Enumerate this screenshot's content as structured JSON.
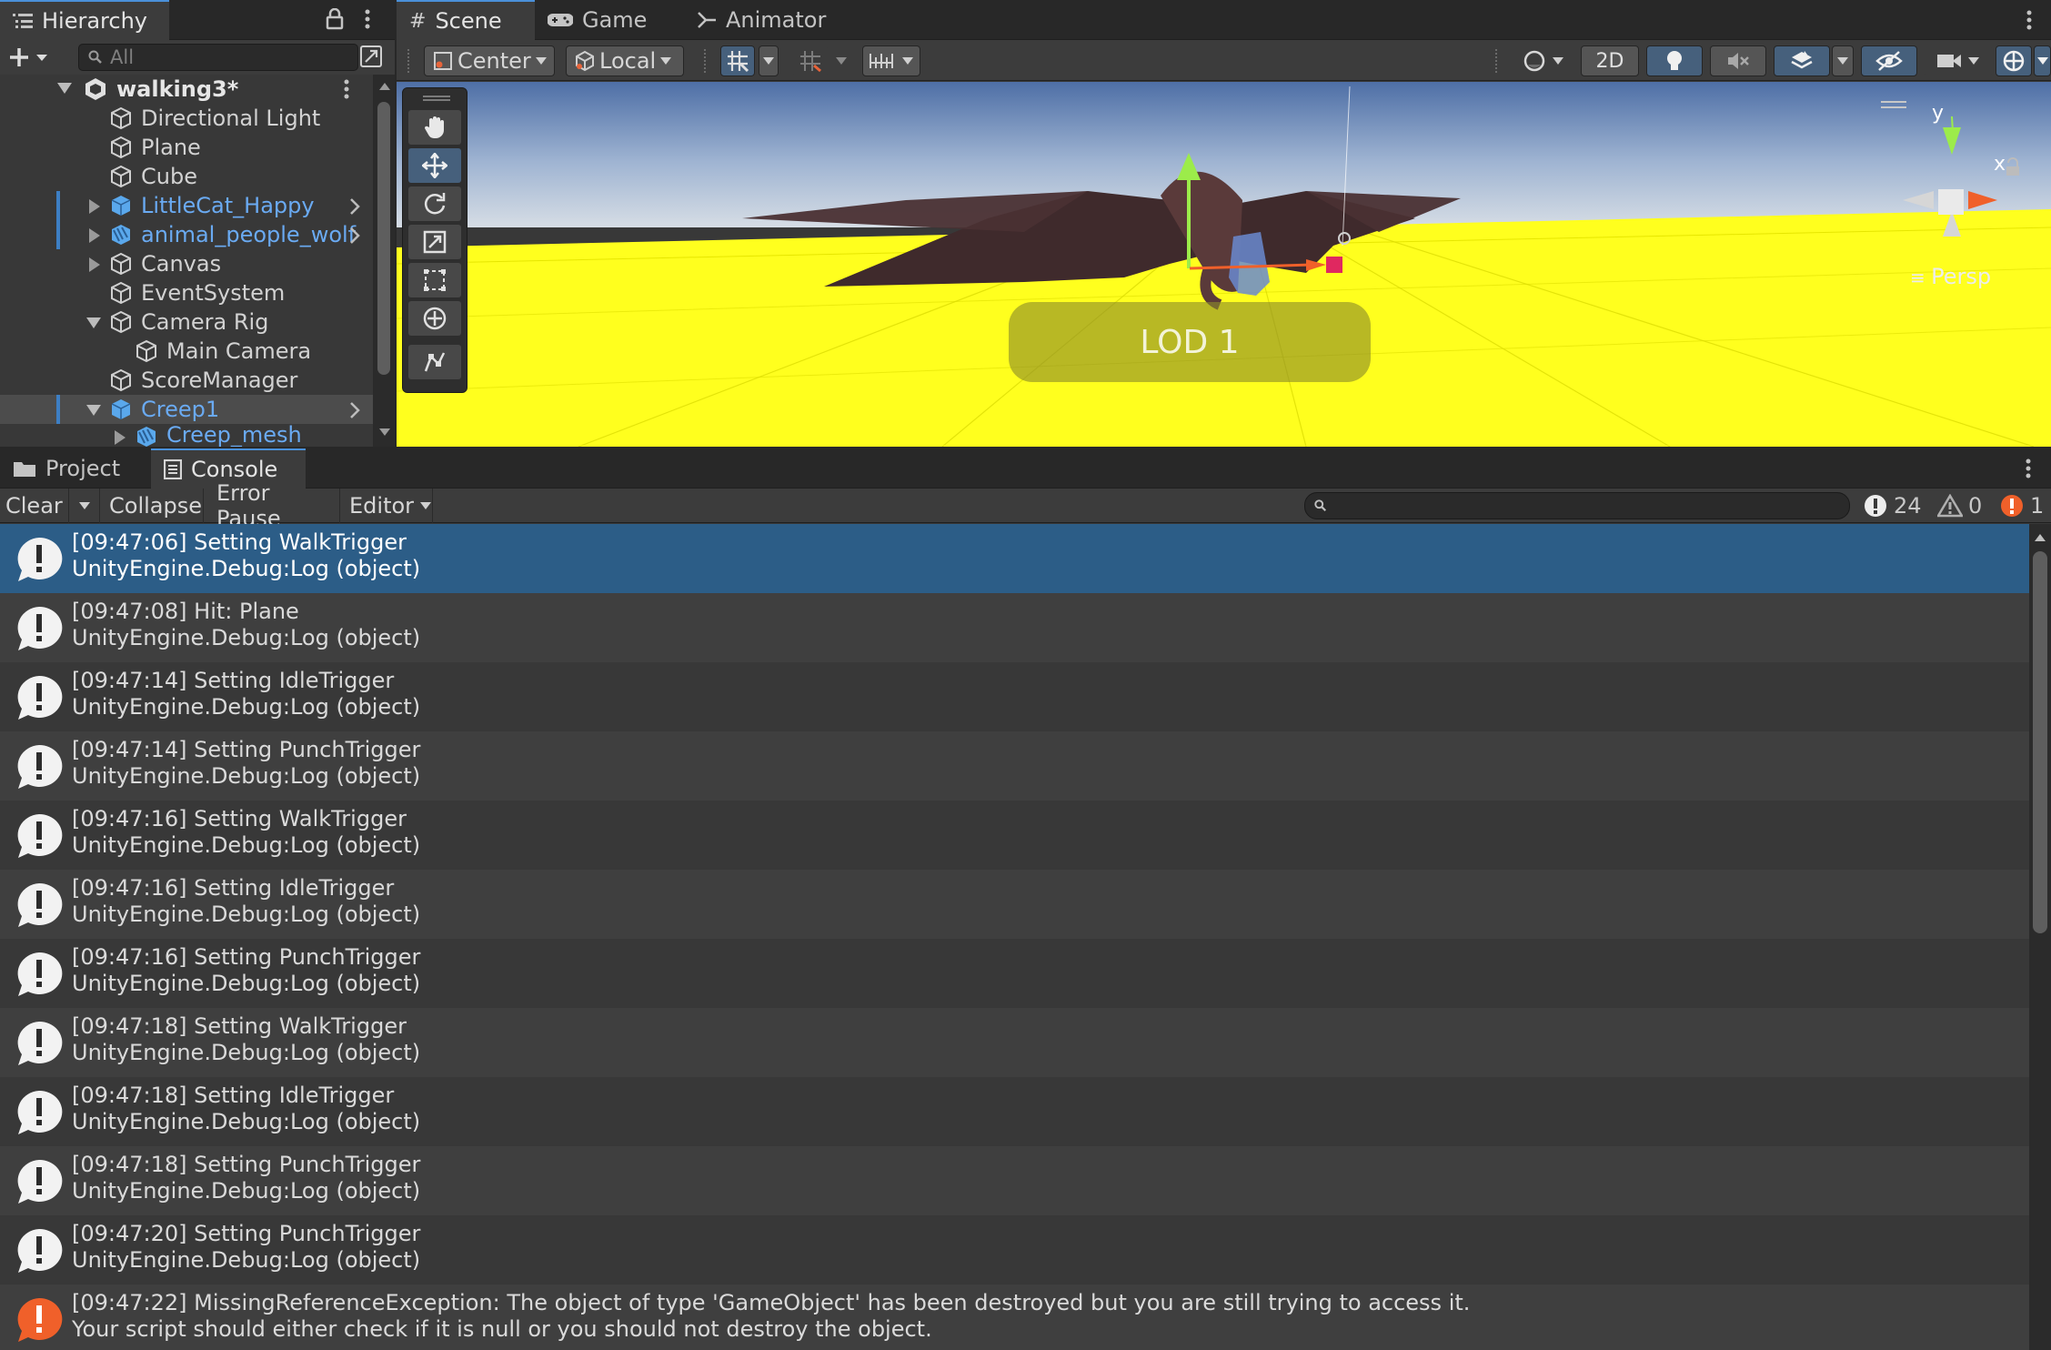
{
  "hierarchy": {
    "tab_label": "Hierarchy",
    "search_placeholder": "All",
    "scene_name": "walking3*",
    "items": [
      {
        "label": "Directional Light"
      },
      {
        "label": "Plane"
      },
      {
        "label": "Cube"
      },
      {
        "label": "LittleCat_Happy"
      },
      {
        "label": "animal_people_wolf"
      },
      {
        "label": "Canvas"
      },
      {
        "label": "EventSystem"
      },
      {
        "label": "Camera Rig"
      },
      {
        "label": "Main Camera"
      },
      {
        "label": "ScoreManager"
      },
      {
        "label": "Creep1"
      },
      {
        "label": "Creep_mesh"
      }
    ]
  },
  "scene_tabs": {
    "scene": "Scene",
    "game": "Game",
    "animator": "Animator"
  },
  "scene_toolbar": {
    "pivot": "Center",
    "space": "Local",
    "mode_2d": "2D"
  },
  "scene_view": {
    "lod_label": "LOD 1",
    "gizmo_y": "y",
    "gizmo_x": "x",
    "projection": "Persp"
  },
  "bottom_tabs": {
    "project": "Project",
    "console": "Console"
  },
  "console_toolbar": {
    "clear": "Clear",
    "collapse": "Collapse",
    "error_pause": "Error Pause",
    "editor": "Editor",
    "log_count": "24",
    "warning_count": "0",
    "error_count": "1"
  },
  "logs": [
    {
      "line1": "[09:47:06] Setting WalkTrigger",
      "line2": "UnityEngine.Debug:Log (object)",
      "type": "info"
    },
    {
      "line1": "[09:47:08] Hit: Plane",
      "line2": "UnityEngine.Debug:Log (object)",
      "type": "info"
    },
    {
      "line1": "[09:47:14] Setting IdleTrigger",
      "line2": "UnityEngine.Debug:Log (object)",
      "type": "info"
    },
    {
      "line1": "[09:47:14] Setting PunchTrigger",
      "line2": "UnityEngine.Debug:Log (object)",
      "type": "info"
    },
    {
      "line1": "[09:47:16] Setting WalkTrigger",
      "line2": "UnityEngine.Debug:Log (object)",
      "type": "info"
    },
    {
      "line1": "[09:47:16] Setting IdleTrigger",
      "line2": "UnityEngine.Debug:Log (object)",
      "type": "info"
    },
    {
      "line1": "[09:47:16] Setting PunchTrigger",
      "line2": "UnityEngine.Debug:Log (object)",
      "type": "info"
    },
    {
      "line1": "[09:47:18] Setting WalkTrigger",
      "line2": "UnityEngine.Debug:Log (object)",
      "type": "info"
    },
    {
      "line1": "[09:47:18] Setting IdleTrigger",
      "line2": "UnityEngine.Debug:Log (object)",
      "type": "info"
    },
    {
      "line1": "[09:47:18] Setting PunchTrigger",
      "line2": "UnityEngine.Debug:Log (object)",
      "type": "info"
    },
    {
      "line1": "[09:47:20] Setting PunchTrigger",
      "line2": "UnityEngine.Debug:Log (object)",
      "type": "info"
    },
    {
      "line1": "[09:47:22] MissingReferenceException: The object of type 'GameObject' has been destroyed but you are still trying to access it.",
      "line2": "Your script should either check if it is null or you should not destroy the object.",
      "type": "error"
    }
  ],
  "colors": {
    "selection": "#2c5d87",
    "prefab_blue": "#6aaaf2",
    "ground_yellow": "#ffff1e",
    "error_orange": "#f0602a"
  }
}
